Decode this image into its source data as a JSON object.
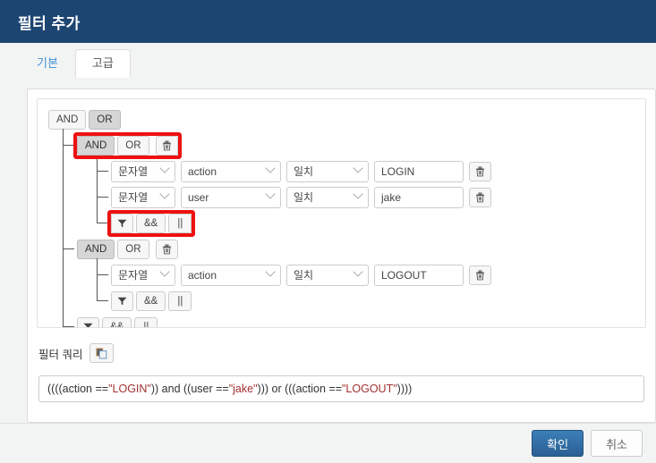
{
  "dialog": {
    "title": "필터 추가"
  },
  "tabs": [
    {
      "label": "기본",
      "active": false
    },
    {
      "label": "고급",
      "active": true
    }
  ],
  "builder": {
    "root": {
      "and_label": "AND",
      "or_label": "OR",
      "selected": "OR"
    },
    "group1": {
      "and_label": "AND",
      "or_label": "OR",
      "selected": "AND",
      "delete_icon": "trash-icon",
      "highlighted": true,
      "conditions": [
        {
          "type": "문자열",
          "field": "action",
          "operator": "일치",
          "value": "LOGIN",
          "delete_icon": "trash-icon"
        },
        {
          "type": "문자열",
          "field": "user",
          "operator": "일치",
          "value": "jake",
          "delete_icon": "trash-icon"
        }
      ],
      "actions": {
        "filter_icon": "funnel-icon",
        "and_label": "&&",
        "or_label": "||",
        "highlighted": true
      }
    },
    "group2": {
      "and_label": "AND",
      "or_label": "OR",
      "selected": "AND",
      "delete_icon": "trash-icon",
      "conditions": [
        {
          "type": "문자열",
          "field": "action",
          "operator": "일치",
          "value": "LOGOUT",
          "delete_icon": "trash-icon"
        }
      ],
      "actions": {
        "filter_icon": "funnel-icon",
        "and_label": "&&",
        "or_label": "||"
      }
    },
    "root_actions": {
      "filter_icon": "funnel-icon",
      "and_label": "&&",
      "or_label": "||"
    }
  },
  "query": {
    "label": "필터 쿼리",
    "copy_icon": "copy-icon",
    "text": "((((action == \"LOGIN\")) and ((user == \"jake\"))) or (((action == \"LOGOUT\"))))",
    "segments": [
      {
        "t": "((((action == ",
        "s": false
      },
      {
        "t": "\"LOGIN\"",
        "s": true
      },
      {
        "t": ")) and ((user == ",
        "s": false
      },
      {
        "t": "\"jake\"",
        "s": true
      },
      {
        "t": "))) or (((action == ",
        "s": false
      },
      {
        "t": "\"LOGOUT\"",
        "s": true
      },
      {
        "t": "))))",
        "s": false
      }
    ]
  },
  "footer": {
    "confirm_label": "확인",
    "cancel_label": "취소"
  },
  "colors": {
    "header_bg": "#1d4571",
    "accent": "#2e6da4",
    "highlight": "#ee1111",
    "string_literal": "#a33030",
    "tab_link": "#3d8fd6"
  }
}
